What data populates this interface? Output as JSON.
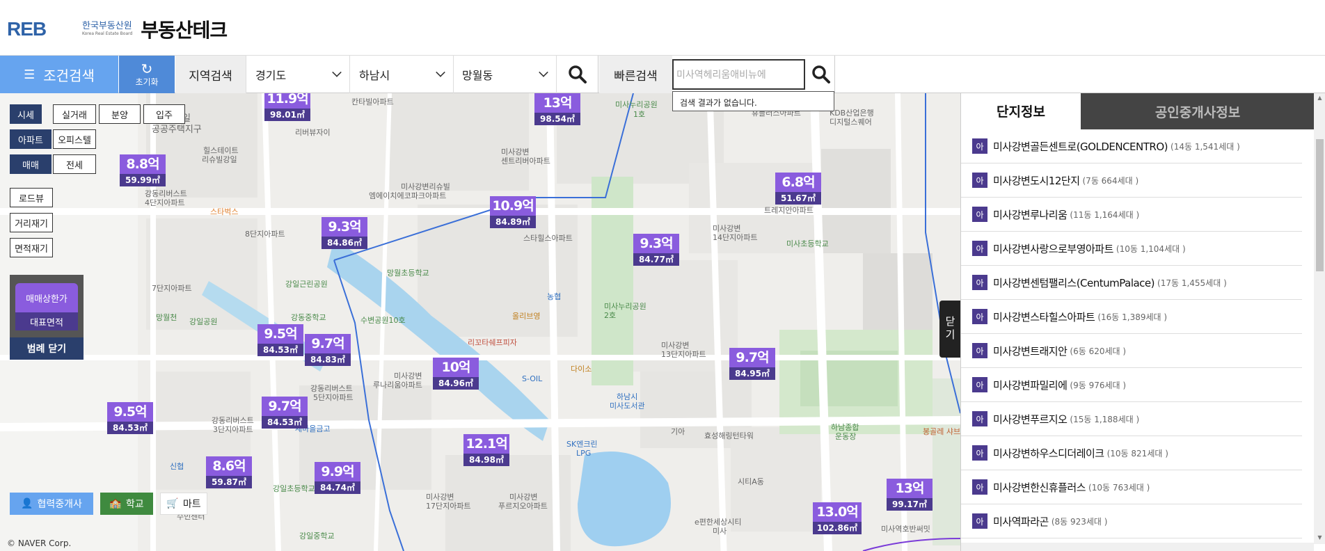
{
  "header": {
    "logo_mark": "REB",
    "logo_kor": "한국부동산원",
    "logo_eng": "Korea Real Estate Board",
    "title": "부동산테크"
  },
  "searchbar": {
    "condition_label": "조건검색",
    "reset_label": "초기화",
    "region_label": "지역검색",
    "province": "경기도",
    "city": "하남시",
    "dong": "망월동",
    "quick_label": "빠른검색",
    "quick_value": "미사역헤리움애비뉴에",
    "no_result": "검색 결과가 없습니다."
  },
  "filters": {
    "type_row1": [
      "시세",
      "실거래",
      "분양",
      "입주"
    ],
    "type_row2": [
      "아파트",
      "오피스텔"
    ],
    "type_row3": [
      "매매",
      "전세"
    ],
    "tools": [
      "로드뷰",
      "거리재기",
      "면적재기"
    ]
  },
  "legend": {
    "top": "매매상한가",
    "bottom": "대표면적",
    "close": "범례 닫기"
  },
  "bottom_buttons": {
    "broker": "협력중개사",
    "school": "학교",
    "mart": "마트"
  },
  "copyright": "© NAVER Corp.",
  "markers": [
    {
      "price": "11.9억",
      "area": "98.01㎡"
    },
    {
      "price": "13억",
      "area": "98.54㎡"
    },
    {
      "price": "8.8억",
      "area": "59.99㎡"
    },
    {
      "price": "6.8억",
      "area": "51.67㎡"
    },
    {
      "price": "10.9억",
      "area": "84.89㎡"
    },
    {
      "price": "9.3억",
      "area": "84.86㎡"
    },
    {
      "price": "9.3억",
      "area": "84.77㎡"
    },
    {
      "price": "9.5억",
      "area": "84.53㎡"
    },
    {
      "price": "9.7억",
      "area": "84.83㎡"
    },
    {
      "price": "10억",
      "area": "84.96㎡"
    },
    {
      "price": "9.7억",
      "area": "84.95㎡"
    },
    {
      "price": "9.5억",
      "area": "84.53㎡"
    },
    {
      "price": "9.7억",
      "area": "84.53㎡"
    },
    {
      "price": "12.1억",
      "area": "84.98㎡"
    },
    {
      "price": "8.6억",
      "area": "59.87㎡"
    },
    {
      "price": "9.9억",
      "area": "84.74㎡"
    },
    {
      "price": "13억",
      "area": "99.17㎡"
    },
    {
      "price": "13.0억",
      "area": "102.86㎡"
    }
  ],
  "map_labels": {
    "l1": "강일",
    "l2": "공공주택지구",
    "l3": "힐스테이트",
    "l4": "리슈빌강일",
    "l5": "강동리버스트",
    "l6": "4단지아파트",
    "l7": "스타벅스",
    "l8": "8단지아파트",
    "l9": "7단지아파트",
    "l10": "망월천",
    "l11": "강일공원",
    "l12": "강일근린공원",
    "l13": "강동중학교",
    "l14": "망월초등학교",
    "l15": "수변공원10호",
    "l16": "미사강변",
    "l17": "센트리버아파트",
    "l18": "미사강변리슈빌",
    "l19": "엠에이치에코파크아파트",
    "l20": "스타힐스아파트",
    "l21": "미사누리공원",
    "l22": "1호",
    "l23": "2호",
    "l24": "올리브영",
    "l25": "농협",
    "l26": "리꼬타쉐프피자",
    "l27": "S-OIL",
    "l28": "다이소",
    "l29": "루나리움아파트",
    "l30": "5단지아파트",
    "l31": "3단지아파트",
    "l32": "새마을금고",
    "l33": "신협",
    "l34": "강일초등학교",
    "l35": "강일중학교",
    "l36": "수민센터",
    "l37": "SK엔크린",
    "l38": "LPG",
    "l39": "17단지아파트",
    "l40": "푸르지오아파트",
    "l41": "하남시",
    "l42": "미사도서관",
    "l43": "13단지아파트",
    "l44": "14단지아파트",
    "l45": "미사초등학교",
    "l46": "KDB산업은행",
    "l47": "디지털스퀘어",
    "l48": "휴플러스아파트",
    "l49": "기아",
    "l50": "효성해링턴타워",
    "l51": "시티A동",
    "l52": "하남종합",
    "l53": "운동장",
    "l54": "봉골레 샤브",
    "l55": "e편한세상시티",
    "l56": "미사",
    "l57": "미사역호반써밋",
    "l58": "칸타빌아파트",
    "l59": "리버뷰자이",
    "l60": "트레지안아파트"
  },
  "panel": {
    "tab_active": "단지정보",
    "tab_inactive": "공인중개사정보",
    "badge": "아",
    "close": "닫기",
    "items": [
      {
        "name": "미사강변골든센트로(GOLDENCENTRO)",
        "info": "(14동 1,541세대 )"
      },
      {
        "name": "미사강변도시12단지",
        "info": "(7동 664세대 )"
      },
      {
        "name": "미사강변루나리움",
        "info": "(11동 1,164세대 )"
      },
      {
        "name": "미사강변사랑으로부영아파트",
        "info": "(10동 1,104세대 )"
      },
      {
        "name": "미사강변센텀팰리스(CentumPalace)",
        "info": "(17동 1,455세대 )"
      },
      {
        "name": "미사강변스타힐스아파트",
        "info": "(16동 1,389세대 )"
      },
      {
        "name": "미사강변트래지안",
        "info": "(6동 620세대 )"
      },
      {
        "name": "미사강변파밀리에",
        "info": "(9동 976세대 )"
      },
      {
        "name": "미사강변푸르지오",
        "info": "(15동 1,188세대 )"
      },
      {
        "name": "미사강변하우스디더레이크",
        "info": "(10동 821세대 )"
      },
      {
        "name": "미사강변한신휴플러스",
        "info": "(10동 763세대 )"
      },
      {
        "name": "미사역파라곤",
        "info": "(8동 923세대 )"
      }
    ]
  }
}
